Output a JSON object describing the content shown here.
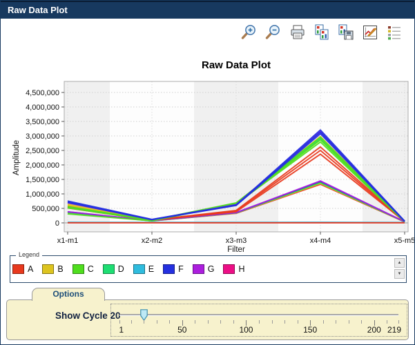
{
  "window": {
    "title": "Raw Data Plot"
  },
  "toolbar": {
    "buttons": [
      "zoom-in",
      "zoom-out",
      "print",
      "copy-chart",
      "save-chart",
      "edit-chart",
      "toggle-legend"
    ]
  },
  "chart_data": {
    "type": "line",
    "title": "Raw Data Plot",
    "xlabel": "Filter",
    "ylabel": "Amplitude",
    "categories": [
      "x1-m1",
      "x2-m2",
      "x3-m3",
      "x4-m4",
      "x5-m5"
    ],
    "ylim": [
      0,
      4750000
    ],
    "grid": "dotted",
    "yticks": [
      {
        "value": 0,
        "label": "0"
      },
      {
        "value": 500000,
        "label": "500,000"
      },
      {
        "value": 1000000,
        "label": "1,000,000"
      },
      {
        "value": 1500000,
        "label": "1,500,000"
      },
      {
        "value": 2000000,
        "label": "2,000,000"
      },
      {
        "value": 2500000,
        "label": "2,500,000"
      },
      {
        "value": 3000000,
        "label": "3,000,000"
      },
      {
        "value": 3500000,
        "label": "3,500,000"
      },
      {
        "value": 4000000,
        "label": "4,000,000"
      },
      {
        "value": 4500000,
        "label": "4,500,000"
      }
    ],
    "series": [
      {
        "group": "H",
        "values": [
          9000,
          8000,
          9000,
          9000,
          8000
        ]
      },
      {
        "group": "E",
        "values": [
          20000,
          17000,
          18000,
          20000,
          16000
        ]
      },
      {
        "group": "A",
        "values": [
          4000,
          4000,
          4000,
          4000,
          4000
        ]
      },
      {
        "group": "A",
        "values": [
          350000,
          68000,
          330000,
          1330000,
          34000
        ]
      },
      {
        "group": "B",
        "values": [
          370000,
          72000,
          340000,
          1365000,
          36000
        ]
      },
      {
        "group": "D",
        "values": [
          360000,
          70000,
          345000,
          1385000,
          35000
        ]
      },
      {
        "group": "C",
        "values": [
          375000,
          74000,
          350000,
          1405000,
          37000
        ]
      },
      {
        "group": "F",
        "values": [
          380000,
          76000,
          352000,
          1430000,
          38000
        ]
      },
      {
        "group": "G",
        "values": [
          385000,
          78000,
          355000,
          1448000,
          39000
        ]
      },
      {
        "group": "A",
        "values": [
          580000,
          98000,
          430000,
          2620000,
          52000
        ]
      },
      {
        "group": "A",
        "values": [
          550000,
          94000,
          410000,
          2500000,
          48000
        ]
      },
      {
        "group": "A",
        "values": [
          515000,
          90000,
          385000,
          2370000,
          45000
        ]
      },
      {
        "group": "B",
        "values": [
          640000,
          105000,
          650000,
          2980000,
          50000
        ]
      },
      {
        "group": "B",
        "values": [
          610000,
          100000,
          635000,
          2895000,
          48000
        ]
      },
      {
        "group": "D",
        "values": [
          540000,
          92000,
          680000,
          2915000,
          45000
        ]
      },
      {
        "group": "C",
        "values": [
          560000,
          95000,
          690000,
          2955000,
          46000
        ]
      },
      {
        "group": "C",
        "values": [
          520000,
          88000,
          668000,
          2865000,
          44000
        ]
      },
      {
        "group": "C",
        "values": [
          310000,
          70000,
          655000,
          2790000,
          42000
        ]
      },
      {
        "group": "G",
        "values": [
          690000,
          112000,
          630000,
          3155000,
          50000
        ]
      },
      {
        "group": "F",
        "values": [
          755000,
          120000,
          622000,
          3205000,
          60000
        ]
      },
      {
        "group": "F",
        "values": [
          722000,
          115000,
          610000,
          3130000,
          55000
        ]
      },
      {
        "group": "F",
        "values": [
          702000,
          110000,
          600000,
          3075000,
          52000
        ]
      }
    ]
  },
  "legend": {
    "label": "Legend",
    "colors": {
      "A": "#E8391D",
      "B": "#DDC41F",
      "C": "#4FDE1E",
      "D": "#1EDE73",
      "E": "#2FBCDE",
      "F": "#2430E0",
      "G": "#AC1EDE",
      "H": "#ED0E86"
    },
    "items": [
      "A",
      "B",
      "C",
      "D",
      "E",
      "F",
      "G",
      "H"
    ]
  },
  "options": {
    "tab_label": "Options",
    "show_cycle_label": "Show Cycle 20",
    "slider": {
      "min": 1,
      "max": 219,
      "value": 20,
      "tick_labels": [
        "1",
        "50",
        "100",
        "150",
        "200",
        "219"
      ]
    }
  }
}
